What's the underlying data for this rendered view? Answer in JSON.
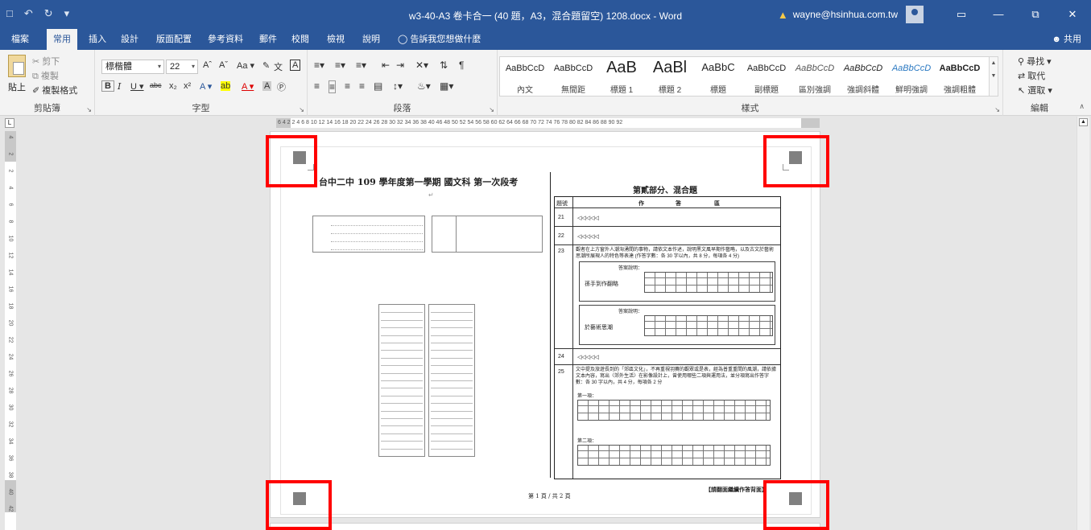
{
  "window": {
    "title": "w3-40-A3 卷卡合一 (40 題，A3，混合題留空) 1208.docx - Word",
    "user_email": "wayne@hsinhua.com.tw",
    "qat": [
      "save-icon",
      "undo-icon",
      "redo-icon",
      "customize-icon"
    ]
  },
  "tabs": [
    "檔案",
    "常用",
    "插入",
    "設計",
    "版面配置",
    "參考資料",
    "郵件",
    "校閱",
    "檢視",
    "說明"
  ],
  "active_tab": "常用",
  "tell_me": "告訴我您想做什麼",
  "share": "共用",
  "ribbon": {
    "clipboard": {
      "label": "剪貼簿",
      "paste": "貼上",
      "cut": "剪下",
      "copy": "複製",
      "format_painter": "複製格式"
    },
    "font": {
      "label": "字型",
      "font_name": "標楷體",
      "font_size": "22",
      "case": "Aa"
    },
    "paragraph": {
      "label": "段落"
    },
    "styles": {
      "label": "樣式",
      "items": [
        {
          "sample": "AaBbCcD",
          "name": "內文"
        },
        {
          "sample": "AaBbCcD",
          "name": "無間距"
        },
        {
          "sample": "AaB",
          "name": "標題 1"
        },
        {
          "sample": "AaBl",
          "name": "標題 2"
        },
        {
          "sample": "AaBbC",
          "name": "標題"
        },
        {
          "sample": "AaBbCcD",
          "name": "副標題"
        },
        {
          "sample": "AaBbCcD",
          "name": "區別強調"
        },
        {
          "sample": "AaBbCcD",
          "name": "強調斜體"
        },
        {
          "sample": "AaBbCcD",
          "name": "鮮明強調"
        },
        {
          "sample": "AaBbCcD",
          "name": "強調粗體"
        }
      ]
    },
    "editing": {
      "label": "編輯",
      "find": "尋找",
      "replace": "取代",
      "select": "選取"
    }
  },
  "ruler": {
    "h_text": "6 4 2   2 4 6 8 10 12 14 16 18 20 22 24 26 28 30 32 34 36 38 40     46 48 50 52 54 56 58 60 62 64 66 68 70 72 74 76 78 80 82 84 86 88 90 92",
    "v_ticks": [
      "4",
      "2",
      "2",
      "4",
      "6",
      "8",
      "10",
      "12",
      "14",
      "16",
      "18",
      "20",
      "22",
      "24",
      "26",
      "28",
      "30",
      "32",
      "34",
      "36",
      "38",
      "40",
      "42"
    ]
  },
  "document": {
    "title": "台中二中 109 學年度第一學期 國文科 第一次段考",
    "section_title": "第貳部分、混合題",
    "table_header": [
      "題號",
      "作",
      "答",
      "區"
    ],
    "questions": [
      "21",
      "22",
      "23",
      "24",
      "25"
    ],
    "q23_text": "觀者在上方窗外人潮洶湧間的事物，請依文本作述，說明黑文風早期作藝略，以及古文於藝術思潮所展現人的特色等表達  (作答字數：各 30 字以內，共 8 分，每項各 4 分)",
    "q23_sub": [
      "孫手到作翻略",
      "於藝術思潮"
    ],
    "q25_text": "文中提及旅遊長到的「郊區文化」，不再重視羽賽的觀眾或是表，經為普重重間的風潮，請依據文本內容，寫出〈郊外生活〉在影像設計上，曾使用哪些二項與運用法，並分項寫出作答字數：各 30 字以內，共 4 分，每項各 2 分",
    "q25_sub": [
      "第一項：",
      "第二項："
    ],
    "answer_label": "答案說明：",
    "footer_page": "第 1 頁 / 共 2 頁",
    "footer_right": "【請翻面繼續作答背面】"
  },
  "colors": {
    "accent": "#2b579a",
    "highlight": "#ff0000",
    "warning": "#f7c948"
  }
}
